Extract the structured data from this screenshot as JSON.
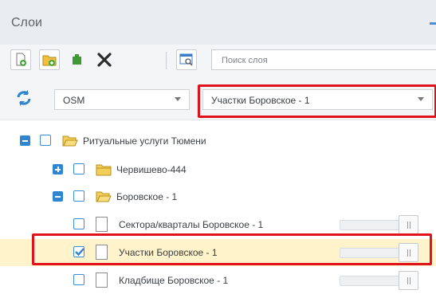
{
  "panel": {
    "title": "Слои"
  },
  "toolbar": {
    "buttons": [
      {
        "icon": "add-layer-icon"
      },
      {
        "icon": "add-folder-icon"
      },
      {
        "icon": "add-component-icon"
      },
      {
        "icon": "delete-icon"
      },
      {
        "icon": "layer-properties-icon"
      }
    ],
    "search": {
      "placeholder": "Поиск слоя",
      "value": ""
    }
  },
  "selectors": {
    "basemap": {
      "value": "OSM"
    },
    "layer": {
      "value": "Участки Боровское - 1"
    }
  },
  "tree": {
    "root": {
      "label": "Ритуальные услуги Тюмени"
    },
    "groups": [
      {
        "label": "Червишево-444",
        "expanded": false
      },
      {
        "label": "Боровское - 1",
        "expanded": true
      }
    ],
    "layers": [
      {
        "label": "Сектора/кварталы Боровское - 1",
        "checked": false,
        "selected": false
      },
      {
        "label": "Участки Боровское - 1",
        "checked": true,
        "selected": true
      },
      {
        "label": "Кладбище Боровское - 1",
        "checked": false,
        "selected": false
      }
    ]
  },
  "colors": {
    "accent": "#2f85cf",
    "highlight": "#e0121b",
    "selected_row": "#fff3cb"
  }
}
